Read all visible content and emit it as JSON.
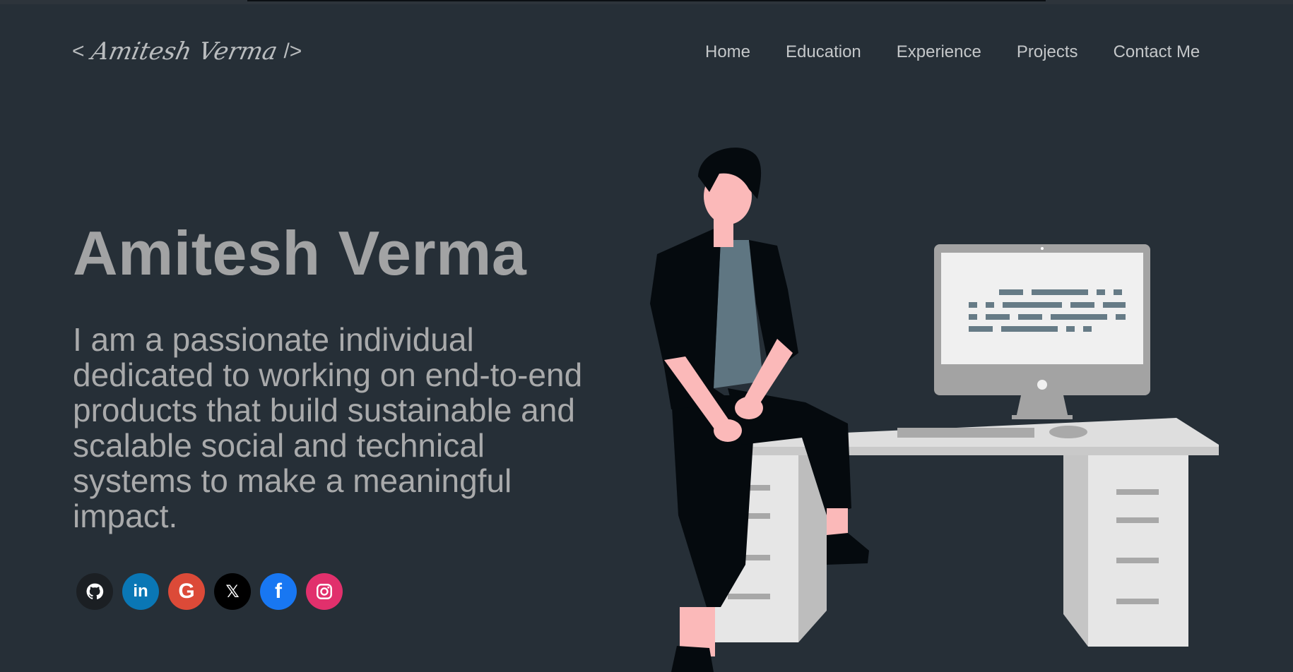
{
  "logo": {
    "open": "<",
    "signature": "Amitesh Verma",
    "close": "/>"
  },
  "nav": {
    "home": "Home",
    "education": "Education",
    "experience": "Experience",
    "projects": "Projects",
    "contact": "Contact Me"
  },
  "hero": {
    "name": "Amitesh Verma",
    "tagline": "I am a passionate individual dedicated to working on end-to-end products that build sustainable and scalable social and technical systems to make a meaningful impact."
  },
  "socials": [
    {
      "icon": "github-icon",
      "glyph": "",
      "color": "#1b1f23"
    },
    {
      "icon": "linkedin-icon",
      "glyph": "in",
      "color": "#0a77b5"
    },
    {
      "icon": "google-icon",
      "glyph": "G",
      "color": "#dc4a38"
    },
    {
      "icon": "x-icon",
      "glyph": "𝕏",
      "color": "#000000"
    },
    {
      "icon": "facebook-icon",
      "glyph": "f",
      "color": "#1877f2"
    },
    {
      "icon": "instagram-icon",
      "glyph": "",
      "color": "#e1306c"
    }
  ],
  "colors": {
    "background": "#262f37",
    "name_text": "#a2a3a4",
    "tagline_text": "#a9aaab",
    "nav_text": "#c4c7c9"
  }
}
